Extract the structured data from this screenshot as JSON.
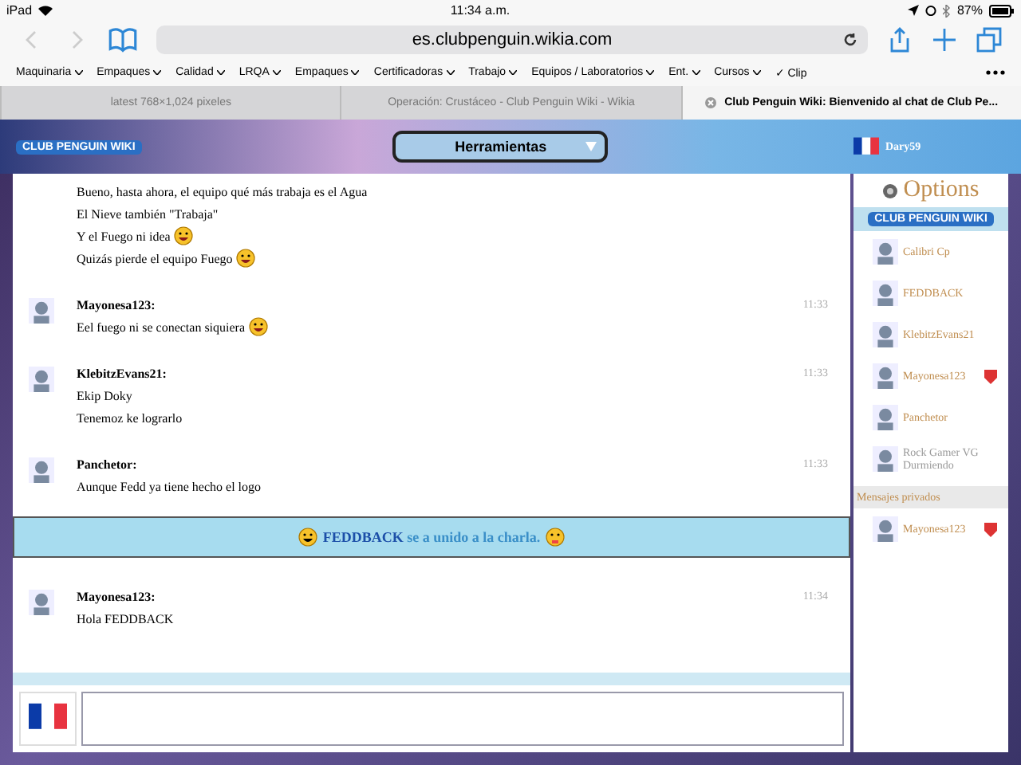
{
  "status_bar": {
    "device": "iPad",
    "time": "11:34 a.m.",
    "battery": "87%"
  },
  "browser": {
    "url": "es.clubpenguin.wikia.com",
    "bookmarks": [
      {
        "label": "Maquinaria",
        "menu": true
      },
      {
        "label": "Empaques",
        "menu": true
      },
      {
        "label": "Calidad",
        "menu": true
      },
      {
        "label": "LRQA",
        "menu": true
      },
      {
        "label": "Empaques",
        "menu": true
      },
      {
        "label": "Certificadoras",
        "menu": true
      },
      {
        "label": "Trabajo",
        "menu": true
      },
      {
        "label": "Equipos / Laboratorios",
        "menu": true
      },
      {
        "label": "Ent.",
        "menu": true
      },
      {
        "label": "Cursos",
        "menu": true
      },
      {
        "label": "✓ Clip",
        "menu": false
      }
    ],
    "tabs": [
      {
        "label": "latest 768×1,024 pixeles",
        "selected": false
      },
      {
        "label": "Operación: Crustáceo - Club Penguin Wiki - Wikia",
        "selected": false
      },
      {
        "label": "Club Penguin Wiki: Bienvenido al chat de Club Pe...",
        "selected": true
      }
    ]
  },
  "chat": {
    "header": {
      "logo": "CLUB PENGUIN WIKI",
      "menu": "Herramientas",
      "user": "Dary59"
    },
    "entries": [
      {
        "kind": "message",
        "lines": [
          {
            "text": "Bueno, hasta ahora, el equipo qué más trabaja es el Agua",
            "emoticon": false
          },
          {
            "text": "El Nieve también \"Trabaja\"",
            "emoticon": false
          },
          {
            "text": "Y el Fuego ni idea",
            "emoticon": true
          },
          {
            "text": "Quizás pierde el equipo Fuego",
            "emoticon": true
          }
        ]
      },
      {
        "kind": "message",
        "user": "Mayonesa123:",
        "time": "11:33",
        "lines": [
          {
            "text": "Eel fuego ni se conectan siquiera",
            "emoticon": true
          }
        ]
      },
      {
        "kind": "message",
        "user": "KlebitzEvans21:",
        "time": "11:33",
        "lines": [
          {
            "text": "Ekip Doky",
            "emoticon": false
          },
          {
            "text": "Tenemoz ke lograrlo",
            "emoticon": false
          }
        ]
      },
      {
        "kind": "message",
        "user": "Panchetor:",
        "time": "11:33",
        "lines": [
          {
            "text": "Aunque Fedd ya tiene hecho el logo",
            "emoticon": false
          }
        ]
      },
      {
        "kind": "join",
        "name": "FEDDBACK",
        "text": "se a unido a la charla."
      },
      {
        "kind": "message",
        "user": "Mayonesa123:",
        "time": "11:34",
        "lines": [
          {
            "text": "Hola FEDDBACK",
            "emoticon": false
          }
        ]
      }
    ]
  },
  "sidebar": {
    "options": "Options",
    "logo": "CLUB PENGUIN WIKI",
    "users": [
      {
        "name": "Calibri Cp",
        "away": false,
        "moderator": false
      },
      {
        "name": "FEDDBACK",
        "away": false,
        "moderator": false
      },
      {
        "name": "KlebitzEvans21",
        "away": false,
        "moderator": false
      },
      {
        "name": "Mayonesa123",
        "away": false,
        "moderator": true
      },
      {
        "name": "Panchetor",
        "away": false,
        "moderator": false
      },
      {
        "name": "Rock Gamer VG",
        "status": "Durmiendo",
        "away": true,
        "moderator": false
      }
    ],
    "private_header": "Mensajes privados",
    "private": [
      {
        "name": "Mayonesa123",
        "moderator": true
      }
    ]
  }
}
